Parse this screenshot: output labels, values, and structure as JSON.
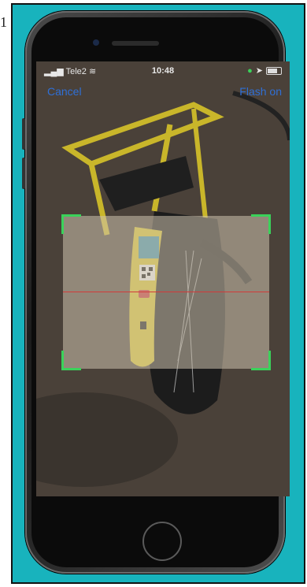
{
  "status_bar": {
    "carrier": "Tele2",
    "time": "10:48"
  },
  "nav": {
    "cancel_label": "Cancel",
    "flash_label": "Flash on"
  },
  "colors": {
    "frame_background": "#18b3bd",
    "nav_accent": "#2f6fd6",
    "scan_bracket": "#3ad25a",
    "scan_line": "#d23a3a"
  },
  "icons": [
    "signal-icon",
    "wifi-icon",
    "location-icon",
    "battery-icon"
  ]
}
